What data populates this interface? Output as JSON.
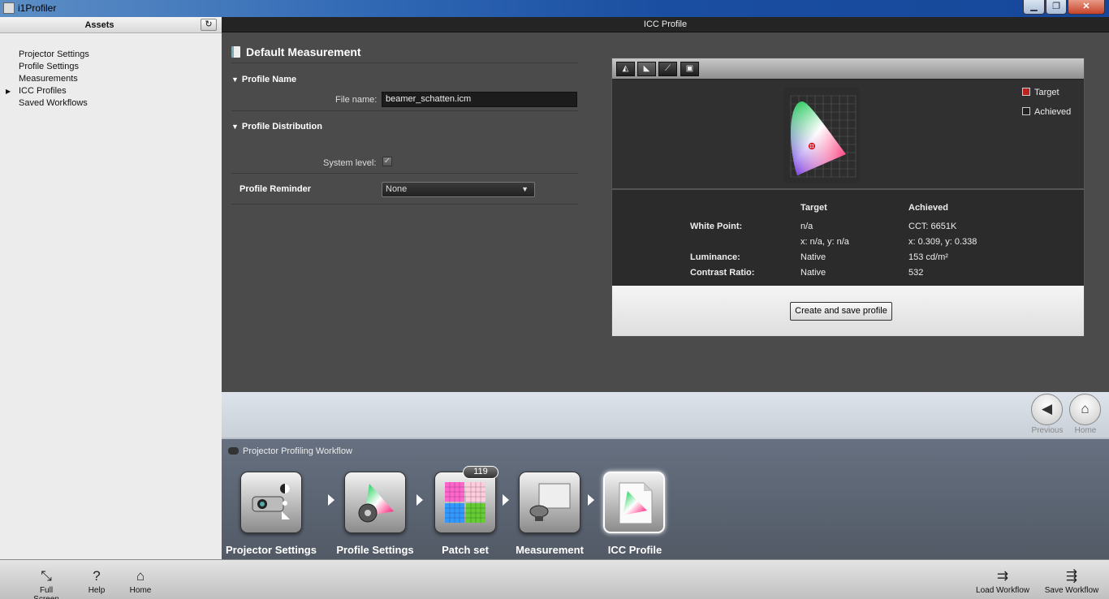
{
  "window": {
    "title": "i1Profiler",
    "min_glyph": "▁",
    "max_glyph": "❐",
    "close_glyph": "✕"
  },
  "sidebar": {
    "header": "Assets",
    "items": [
      {
        "label": "Projector Settings"
      },
      {
        "label": "Profile Settings"
      },
      {
        "label": "Measurements"
      },
      {
        "label": "ICC Profiles"
      },
      {
        "label": "Saved Workflows"
      }
    ]
  },
  "main": {
    "header": "ICC Profile",
    "section_title": "Default Measurement",
    "profile_name": {
      "title": "Profile Name",
      "file_label": "File name:",
      "file_value": "beamer_schatten.icm"
    },
    "profile_distribution": {
      "title": "Profile Distribution",
      "system_label": "System level:",
      "system_checked": true
    },
    "profile_reminder": {
      "label": "Profile Reminder",
      "value": "None"
    }
  },
  "icc_panel": {
    "legend": [
      {
        "label": "Target"
      },
      {
        "label": "Achieved"
      }
    ],
    "columns": {
      "target": "Target",
      "achieved": "Achieved"
    },
    "rows": [
      {
        "label": "White Point:",
        "target": "n/a",
        "achieved": "CCT: 6651K"
      },
      {
        "label": "",
        "target": "x: n/a, y: n/a",
        "achieved": "x: 0.309, y: 0.338"
      },
      {
        "label": "Luminance:",
        "target": "Native",
        "achieved": "153 cd/m²"
      },
      {
        "label": "Contrast Ratio:",
        "target": "Native",
        "achieved": "532"
      }
    ],
    "button": "Create and save profile"
  },
  "nav": {
    "previous": "Previous",
    "home": "Home"
  },
  "workflow": {
    "title": "Projector Profiling Workflow",
    "patch_count": "119",
    "steps": [
      {
        "label": "Projector Settings"
      },
      {
        "label": "Profile Settings"
      },
      {
        "label": "Patch set"
      },
      {
        "label": "Measurement"
      },
      {
        "label": "ICC Profile"
      }
    ]
  },
  "bottom": {
    "full_screen": "Full Screen",
    "help": "Help",
    "home": "Home",
    "load_workflow": "Load Workflow",
    "save_workflow": "Save Workflow"
  },
  "colors": {
    "title_blue": "#1a4ea0",
    "panel_dark": "#2b2b2b",
    "workflow_bg": "#5a626e"
  }
}
